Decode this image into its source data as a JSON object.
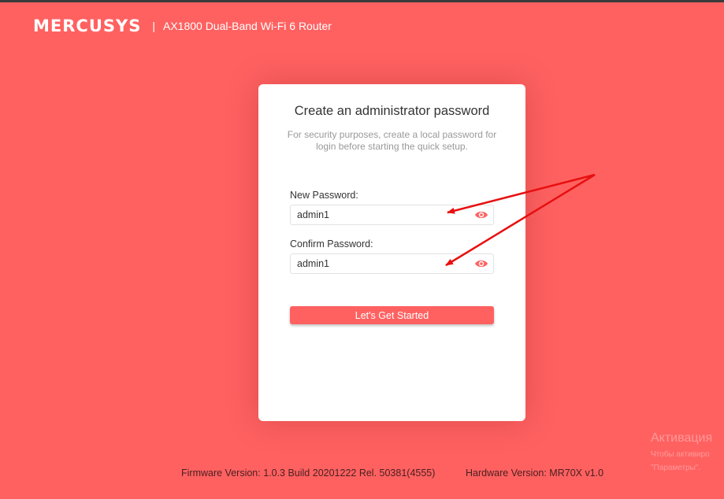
{
  "header": {
    "logo": "MERCUSYS",
    "separator": "|",
    "model": "AX1800 Dual-Band Wi-Fi 6 Router"
  },
  "card": {
    "title": "Create an administrator password",
    "description": "For security purposes, create a local password for login before starting the quick setup.",
    "new_password": {
      "label": "New Password:",
      "value": "admin1",
      "icon": "eye-icon"
    },
    "confirm_password": {
      "label": "Confirm Password:",
      "value": "admin1",
      "icon": "eye-icon"
    },
    "button_label": "Let's Get Started"
  },
  "footer": {
    "firmware": "Firmware Version: 1.0.3 Build 20201222 Rel. 50381(4555)",
    "hardware": "Hardware Version: MR70X v1.0"
  },
  "watermark": {
    "title": "Активация",
    "line1": "Чтобы активиро",
    "line2": "\"Параметры\"."
  },
  "colors": {
    "background": "#ff6161",
    "accent": "#ff6161",
    "annotation_arrow": "#e81010"
  }
}
